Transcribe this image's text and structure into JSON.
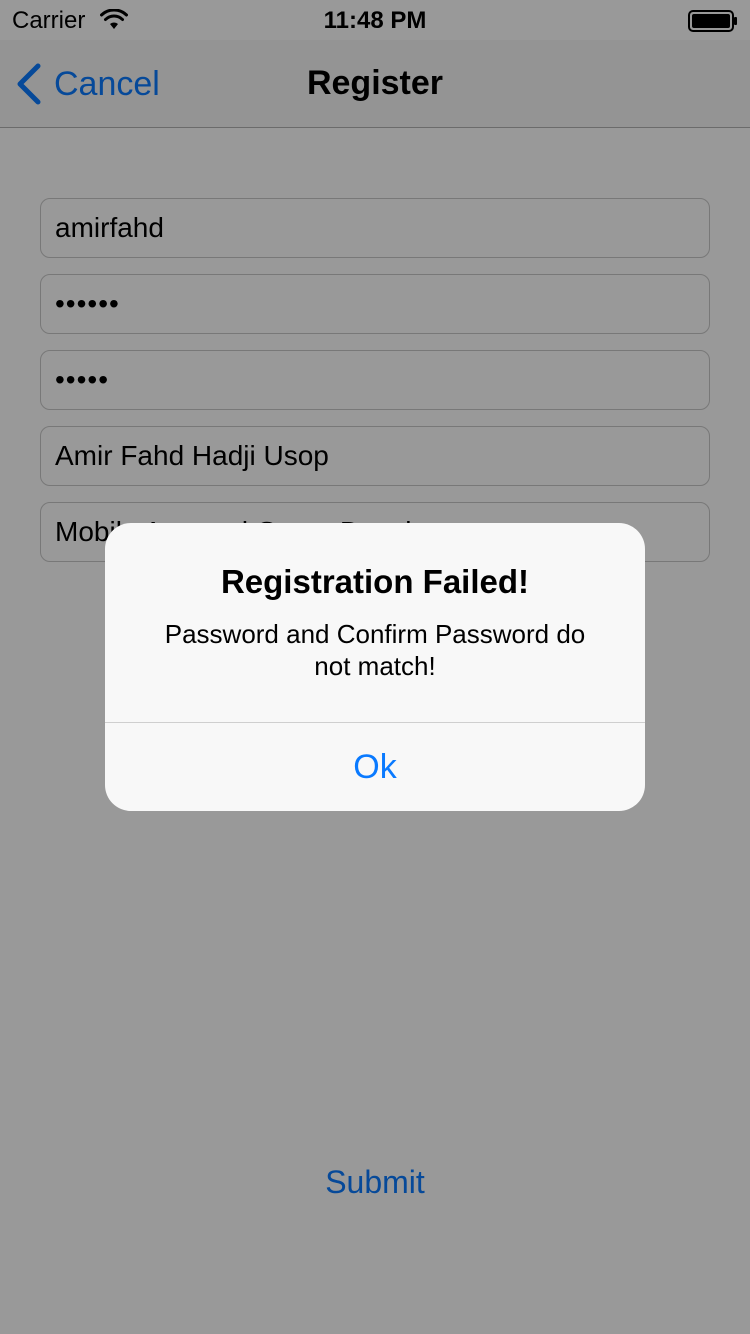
{
  "status_bar": {
    "carrier": "Carrier",
    "time": "11:48 PM",
    "wifi_icon": "wifi-icon",
    "battery_icon": "battery-icon"
  },
  "nav": {
    "back_label": "Cancel",
    "title": "Register",
    "back_icon": "chevron-left-icon"
  },
  "form": {
    "username_value": "amirfahd",
    "password_value": "••••••",
    "confirm_password_value": "•••••",
    "full_name_value": "Amir Fahd Hadji Usop",
    "occupation_value": "Mobile App and Game Developer"
  },
  "submit_label": "Submit",
  "alert": {
    "title": "Registration Failed!",
    "message": "Password and Confirm Password do not match!",
    "button_label": "Ok"
  },
  "colors": {
    "accent": "#0a7aff",
    "overlay": "rgba(0,0,0,0.4)",
    "alert_background": "#f8f8f8"
  }
}
